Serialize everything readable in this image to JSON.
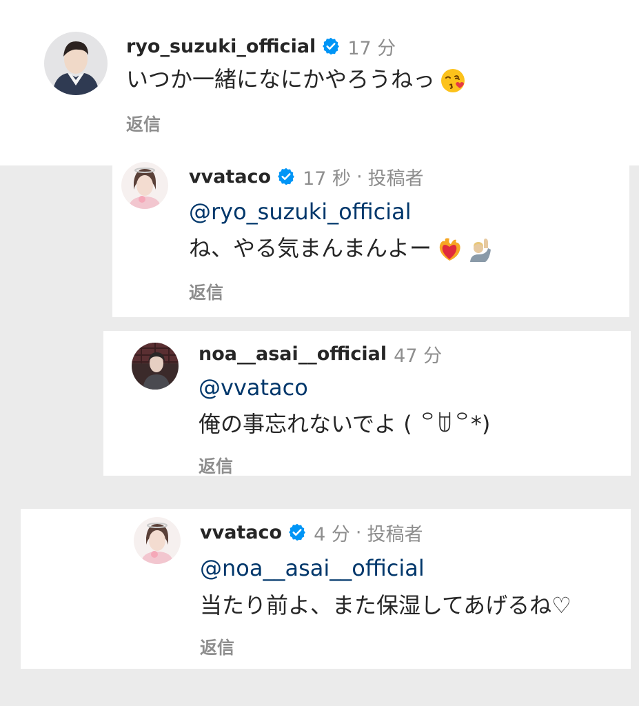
{
  "comments": [
    {
      "username": "ryo_suzuki_official",
      "time": "17 分",
      "text": "いつか一緒になにかやろうねっ",
      "emoji": [
        "kissing-face-with-heart-icon"
      ],
      "reply_label": "返信"
    },
    {
      "username": "vvataco",
      "time": "17 秒",
      "separator": "·",
      "role": "投稿者",
      "mention": "@ryo_suzuki_official",
      "text": "ね、やる気まんまんよー",
      "emoji": [
        "heart-on-fire-icon",
        "raising-hand-icon"
      ],
      "reply_label": "返信"
    },
    {
      "username": "noa__asai__official",
      "time": "47 分",
      "mention": "@vvataco",
      "text": "俺の事忘れないでよ ( ꒪ꌂ꒪*)",
      "reply_label": "返信"
    },
    {
      "username": "vvataco",
      "time": "4 分",
      "separator": "·",
      "role": "投稿者",
      "mention": "@noa__asai__official",
      "text": "当たり前よ、また保湿してあげるね♡",
      "reply_label": "返信"
    }
  ],
  "colors": {
    "verified": "#0095f6",
    "mention": "#00376b",
    "muted": "#8e8e8e",
    "text": "#262626"
  }
}
